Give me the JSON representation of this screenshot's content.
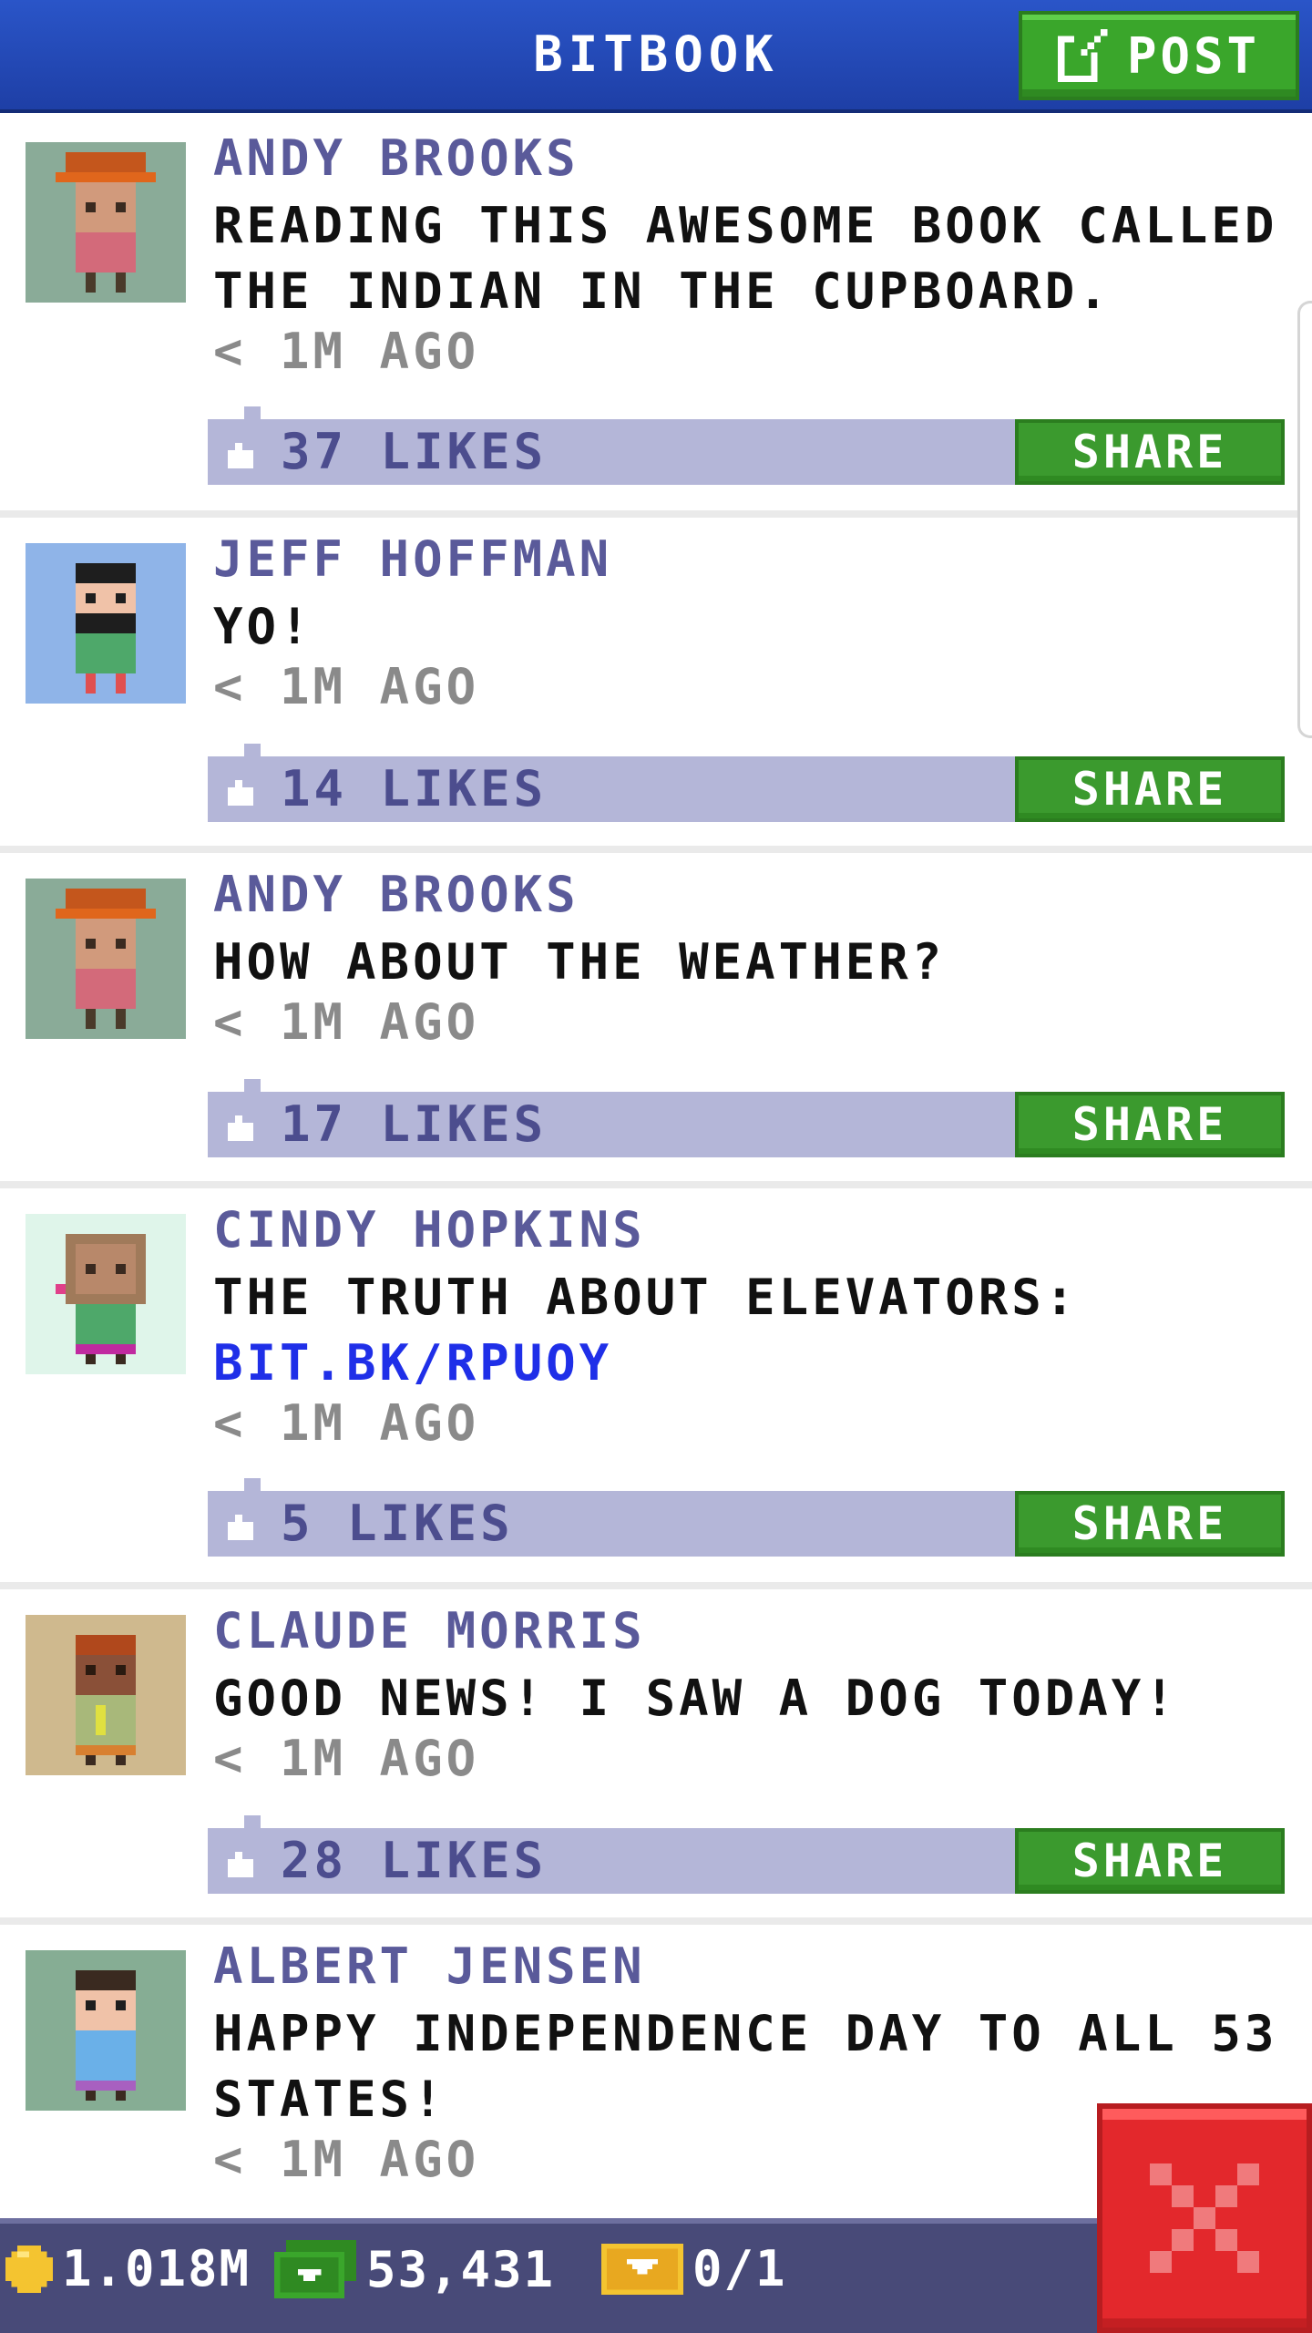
{
  "header": {
    "title": "BITBOOK",
    "post_label": "POST"
  },
  "posts": [
    {
      "author": "ANDY BROOKS",
      "message": "READING THIS AWESOME BOOK CALLED THE INDIAN IN THE CUPBOARD.",
      "time": "< 1M AGO",
      "likes": "37 LIKES",
      "share_label": "SHARE",
      "avatar_bg": "#8aab98",
      "avatar_icon": "avatar-orange-hat-icon"
    },
    {
      "author": "JEFF HOFFMAN",
      "message": "YO!",
      "time": "< 1M AGO",
      "likes": "14 LIKES",
      "share_label": "SHARE",
      "avatar_bg": "#8fb4e8",
      "avatar_icon": "avatar-bearded-man-icon"
    },
    {
      "author": "ANDY BROOKS",
      "message": "HOW ABOUT THE WEATHER?",
      "time": "< 1M AGO",
      "likes": "17 LIKES",
      "share_label": "SHARE",
      "avatar_bg": "#8aab98",
      "avatar_icon": "avatar-orange-hat-icon"
    },
    {
      "author": "CINDY HOPKINS",
      "message": "THE TRUTH ABOUT ELEVATORS:",
      "link": "BIT.BK/RPUOY",
      "time": "< 1M AGO",
      "likes": "5 LIKES",
      "share_label": "SHARE",
      "avatar_bg": "#dff5ea",
      "avatar_icon": "avatar-woman-icon"
    },
    {
      "author": "CLAUDE MORRIS",
      "message": "GOOD NEWS! I SAW A DOG TODAY!",
      "time": "< 1M AGO",
      "likes": "28 LIKES",
      "share_label": "SHARE",
      "avatar_bg": "#cfb98e",
      "avatar_icon": "avatar-redhead-man-icon"
    },
    {
      "author": "ALBERT JENSEN",
      "message": "HAPPY INDEPENDENCE DAY TO ALL 53 STATES!",
      "time": "< 1M AGO",
      "avatar_bg": "#86ad94",
      "avatar_icon": "avatar-blue-shirt-man-icon"
    }
  ],
  "bottom_bar": {
    "coins": "1.018M",
    "bux": "53,431",
    "tickets": "0/1"
  },
  "colors": {
    "header_blue": "#2a55c8",
    "post_green": "#3aa62b",
    "likes_bar": "#b4b6d8",
    "close_red": "#e3282c"
  }
}
